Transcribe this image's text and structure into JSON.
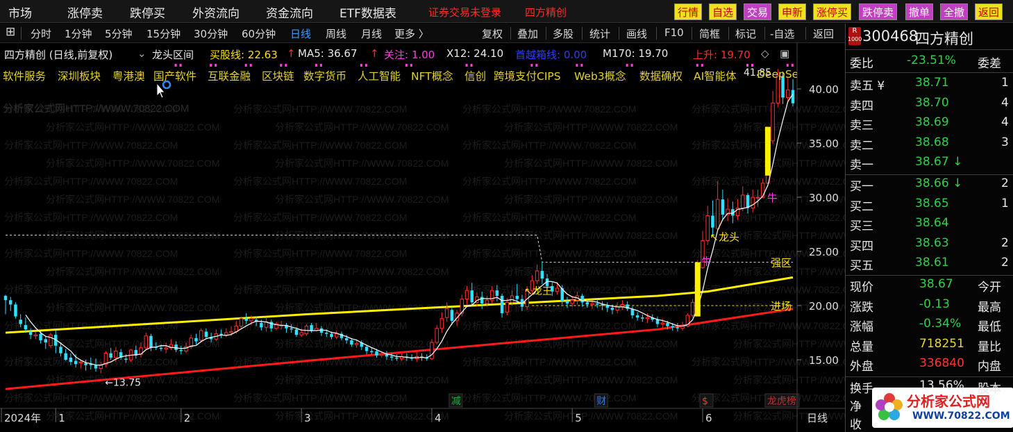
{
  "top_menu": {
    "items": [
      "市场",
      "涨停卖",
      "跌停买",
      "外资流向",
      "资金流向",
      "ETF数据表"
    ],
    "login": "证券交易未登录",
    "stock_title": "四方精创",
    "quick_buttons": [
      "行情",
      "自选",
      "交易",
      "申新",
      "涨停买",
      "跌停卖",
      "撤单",
      "全撤",
      "返回"
    ]
  },
  "toolbar": {
    "periods": [
      "分时",
      "1分钟",
      "5分钟",
      "15分钟",
      "30分钟",
      "60分钟",
      "日线",
      "周线",
      "月线",
      "更多 〉"
    ],
    "active": "日线",
    "actions": [
      "复权",
      "叠加",
      "多股",
      "统计",
      "画线",
      "F10",
      "简框",
      "标记",
      "-自选",
      "返回"
    ]
  },
  "indicator_line": {
    "name": "四方精创 (日线,前复权)",
    "formula": "龙头区间",
    "buy_line": "买股线: 22.63",
    "ma5": "MA5: 36.67",
    "focus": "关注: 1.00",
    "x12": "X12: 24.10",
    "breakout": "首越箱线: 0.00",
    "m170": "M170: 19.70",
    "rise": "上升: 19.70"
  },
  "concepts": [
    "软件服务",
    "深圳板块",
    "粤港澳",
    "国产软件",
    "互联金融",
    "区块链",
    "数字货币",
    "人工智能",
    "NFT概念",
    "信创",
    "跨境支付CIPS",
    "Web3概念",
    "数据确权",
    "AI智能体",
    "DeepSe"
  ],
  "watermark": "分析家公式网HTTP://WWW.70822.COM",
  "chart_labels": {
    "low_label": "←13.75",
    "high_label": "41.85",
    "dragon_head": "↖龙头",
    "strong_zone": "强区",
    "entry_zone": "进场",
    "bull_1": "牛",
    "bull_2": "牛",
    "king": "↖龙王",
    "events": [
      "减",
      "财",
      "$",
      "龙虎榜"
    ]
  },
  "chart_data": {
    "type": "candlestick",
    "y_ticks": [
      "40.00",
      "35.00",
      "30.00",
      "25.00",
      "20.00",
      "15.00"
    ],
    "ylim": [
      13.0,
      42.5
    ],
    "x_ticks": [
      "2024年",
      "1",
      "2",
      "3",
      "4",
      "5",
      "6"
    ],
    "period_label": "日线",
    "x_tick_days": [
      0,
      10,
      35,
      59,
      85,
      113,
      139
    ],
    "n_days": 158,
    "lines": {
      "red_rising": [
        {
          "d": 0,
          "v": 12.3
        },
        {
          "d": 60,
          "v": 14.9
        },
        {
          "d": 130,
          "v": 17.8
        },
        {
          "d": 157,
          "v": 19.7
        }
      ],
      "yellow_box": [
        {
          "d": 0,
          "v": 17.5
        },
        {
          "d": 60,
          "v": 19.2
        },
        {
          "d": 130,
          "v": 20.9
        },
        {
          "d": 140,
          "v": 21.3
        },
        {
          "d": 157,
          "v": 22.6
        }
      ],
      "white_dashed": [
        {
          "d": 0,
          "v": 26.5
        },
        {
          "d": 106,
          "v": 26.5
        },
        {
          "d": 107,
          "v": 24.0
        },
        {
          "d": 157,
          "v": 24.0
        }
      ],
      "yellow_dashed": [
        {
          "d": 105,
          "v": 20.0
        },
        {
          "d": 157,
          "v": 20.0
        }
      ]
    },
    "candles": [
      [
        0,
        20.9,
        20.5,
        21.0,
        19.2
      ],
      [
        1,
        20.5,
        20.1,
        20.8,
        19.5
      ],
      [
        2,
        20.1,
        19.0,
        20.3,
        18.8
      ],
      [
        3,
        18.7,
        18.3,
        19.2,
        18.0
      ],
      [
        4,
        18.2,
        17.8,
        18.9,
        17.5
      ],
      [
        5,
        17.6,
        17.3,
        17.9,
        16.9
      ],
      [
        6,
        17.2,
        17.3,
        17.6,
        16.9
      ],
      [
        7,
        17.4,
        16.8,
        17.6,
        16.5
      ],
      [
        8,
        16.9,
        16.6,
        17.2,
        16.0
      ],
      [
        9,
        16.3,
        17.3,
        17.5,
        16.1
      ],
      [
        10,
        17.3,
        16.3,
        17.7,
        15.6
      ],
      [
        11,
        16.2,
        15.6,
        16.6,
        15.3
      ],
      [
        12,
        15.6,
        15.0,
        16.0,
        14.9
      ],
      [
        13,
        15.2,
        14.8,
        15.6,
        14.5
      ],
      [
        14,
        14.9,
        14.6,
        15.5,
        14.3
      ],
      [
        15,
        14.8,
        14.8,
        15.0,
        14.2
      ],
      [
        16,
        14.7,
        14.5,
        15.0,
        14.0
      ],
      [
        17,
        14.6,
        14.5,
        15.2,
        14.1
      ],
      [
        18,
        14.5,
        14.2,
        15.1,
        13.9
      ],
      [
        19,
        14.2,
        14.5,
        14.8,
        13.75
      ],
      [
        20,
        14.6,
        15.6,
        15.8,
        14.3
      ],
      [
        21,
        15.6,
        15.2,
        16.1,
        15.0
      ],
      [
        22,
        15.2,
        15.8,
        16.2,
        14.8
      ],
      [
        23,
        15.7,
        15.2,
        16.0,
        15.0
      ],
      [
        24,
        15.1,
        15.0,
        15.5,
        14.7
      ],
      [
        25,
        15.0,
        15.9,
        16.0,
        14.8
      ],
      [
        26,
        15.9,
        15.4,
        16.3,
        15.1
      ],
      [
        27,
        15.5,
        16.1,
        16.6,
        15.2
      ],
      [
        28,
        16.1,
        17.2,
        17.5,
        15.9
      ],
      [
        29,
        17.2,
        16.1,
        17.4,
        15.8
      ],
      [
        30,
        16.2,
        16.1,
        16.6,
        15.9
      ],
      [
        31,
        16.1,
        16.0,
        16.4,
        15.8
      ],
      [
        32,
        16.0,
        16.1,
        16.6,
        15.6
      ],
      [
        33,
        16.1,
        16.4,
        16.9,
        15.9
      ],
      [
        34,
        16.4,
        15.9,
        16.7,
        15.7
      ],
      [
        35,
        15.9,
        15.8,
        16.3,
        15.5
      ],
      [
        36,
        15.8,
        16.2,
        16.6,
        15.6
      ],
      [
        37,
        16.2,
        17.0,
        17.3,
        16.0
      ],
      [
        38,
        17.0,
        16.7,
        17.4,
        16.4
      ],
      [
        39,
        16.8,
        17.7,
        17.9,
        16.6
      ],
      [
        40,
        17.6,
        17.1,
        17.9,
        16.9
      ],
      [
        41,
        17.1,
        16.9,
        17.5,
        16.6
      ],
      [
        42,
        16.9,
        17.4,
        17.8,
        16.7
      ],
      [
        43,
        17.4,
        17.3,
        17.8,
        17.0
      ],
      [
        44,
        17.3,
        17.5,
        17.9,
        17.1
      ],
      [
        45,
        17.5,
        17.6,
        18.1,
        17.2
      ],
      [
        46,
        17.6,
        18.1,
        18.6,
        17.4
      ],
      [
        47,
        18.1,
        18.8,
        19.0,
        17.9
      ],
      [
        48,
        18.8,
        18.6,
        19.3,
        18.3
      ],
      [
        49,
        18.6,
        18.8,
        19.1,
        18.2
      ],
      [
        50,
        18.7,
        18.5,
        19.0,
        18.1
      ],
      [
        51,
        18.4,
        18.0,
        18.7,
        17.7
      ],
      [
        52,
        18.0,
        18.5,
        18.9,
        17.6
      ],
      [
        53,
        18.5,
        17.9,
        18.7,
        17.6
      ],
      [
        54,
        17.9,
        18.3,
        18.5,
        17.7
      ],
      [
        55,
        18.2,
        18.2,
        18.6,
        17.8
      ],
      [
        56,
        18.2,
        17.9,
        18.4,
        17.5
      ],
      [
        57,
        17.9,
        17.8,
        18.3,
        17.5
      ],
      [
        58,
        17.8,
        17.3,
        18.0,
        17.1
      ],
      [
        59,
        17.3,
        17.5,
        17.9,
        17.1
      ],
      [
        60,
        17.4,
        18.1,
        18.3,
        17.2
      ],
      [
        61,
        18.2,
        17.7,
        18.4,
        17.5
      ],
      [
        62,
        17.7,
        17.9,
        18.4,
        17.6
      ],
      [
        63,
        17.9,
        17.5,
        18.1,
        17.2
      ],
      [
        64,
        17.5,
        17.4,
        17.8,
        17.1
      ],
      [
        65,
        17.4,
        17.1,
        17.6,
        16.9
      ],
      [
        66,
        17.1,
        17.4,
        17.7,
        16.9
      ],
      [
        67,
        17.4,
        17.0,
        17.6,
        16.8
      ],
      [
        68,
        17.0,
        16.8,
        17.3,
        16.5
      ],
      [
        69,
        16.8,
        16.4,
        17.0,
        16.2
      ],
      [
        70,
        16.4,
        16.5,
        16.9,
        16.1
      ],
      [
        71,
        16.6,
        16.2,
        16.8,
        15.9
      ],
      [
        72,
        16.2,
        15.8,
        16.4,
        15.5
      ],
      [
        73,
        15.8,
        15.7,
        16.1,
        15.5
      ],
      [
        74,
        15.8,
        15.4,
        16.0,
        15.2
      ],
      [
        75,
        15.4,
        15.5,
        15.8,
        15.2
      ],
      [
        76,
        15.5,
        15.3,
        15.8,
        15.0
      ],
      [
        77,
        15.3,
        15.2,
        15.6,
        14.9
      ],
      [
        78,
        15.2,
        15.1,
        15.5,
        14.9
      ],
      [
        79,
        15.1,
        15.3,
        15.6,
        14.9
      ],
      [
        80,
        15.3,
        15.2,
        15.6,
        14.9
      ],
      [
        81,
        15.2,
        15.1,
        15.5,
        14.9
      ],
      [
        82,
        15.1,
        15.3,
        15.7,
        14.8
      ],
      [
        83,
        15.3,
        15.2,
        15.6,
        14.9
      ],
      [
        84,
        15.2,
        15.1,
        15.5,
        14.9
      ],
      [
        85,
        15.1,
        16.6,
        16.9,
        15.0
      ],
      [
        86,
        16.6,
        17.9,
        18.2,
        16.4
      ],
      [
        87,
        17.9,
        18.8,
        19.4,
        17.5
      ],
      [
        88,
        18.9,
        19.7,
        20.3,
        18.5
      ],
      [
        89,
        19.6,
        18.6,
        19.9,
        18.2
      ],
      [
        90,
        18.6,
        19.3,
        19.6,
        18.1
      ],
      [
        91,
        19.3,
        20.6,
        21.0,
        19.0
      ],
      [
        92,
        20.6,
        21.4,
        21.8,
        20.1
      ],
      [
        93,
        21.4,
        20.3,
        22.1,
        19.9
      ],
      [
        94,
        20.3,
        20.8,
        21.2,
        19.9
      ],
      [
        95,
        20.8,
        20.2,
        21.3,
        19.7
      ],
      [
        96,
        20.2,
        20.5,
        20.9,
        19.9
      ],
      [
        97,
        20.5,
        21.4,
        21.8,
        20.2
      ],
      [
        98,
        21.4,
        20.9,
        21.9,
        20.4
      ],
      [
        99,
        20.9,
        19.3,
        21.1,
        18.9
      ],
      [
        100,
        19.4,
        20.3,
        20.7,
        19.1
      ],
      [
        101,
        20.3,
        20.9,
        21.4,
        20.0
      ],
      [
        102,
        20.9,
        20.6,
        22.0,
        20.3
      ],
      [
        103,
        20.6,
        19.9,
        21.0,
        19.5
      ],
      [
        104,
        19.9,
        21.4,
        21.8,
        19.6
      ],
      [
        105,
        21.4,
        22.3,
        22.8,
        21.0
      ],
      [
        106,
        22.3,
        23.2,
        23.8,
        22.0
      ],
      [
        107,
        23.2,
        22.5,
        24.0,
        22.0
      ],
      [
        108,
        22.5,
        21.8,
        22.9,
        21.4
      ],
      [
        109,
        21.8,
        21.3,
        22.2,
        20.9
      ],
      [
        110,
        21.3,
        21.6,
        22.2,
        21.0
      ],
      [
        111,
        21.6,
        20.4,
        21.9,
        20.1
      ],
      [
        112,
        20.4,
        20.2,
        20.8,
        19.8
      ],
      [
        113,
        20.2,
        20.5,
        20.9,
        19.9
      ],
      [
        114,
        20.5,
        20.9,
        21.3,
        20.1
      ],
      [
        115,
        20.9,
        20.3,
        21.1,
        19.9
      ],
      [
        116,
        20.3,
        20.1,
        20.6,
        19.8
      ],
      [
        117,
        20.1,
        20.2,
        20.5,
        19.7
      ],
      [
        118,
        20.2,
        20.1,
        20.6,
        19.8
      ],
      [
        119,
        20.1,
        20.0,
        20.4,
        19.6
      ],
      [
        120,
        20.0,
        19.8,
        20.3,
        19.4
      ],
      [
        121,
        19.8,
        19.6,
        20.1,
        19.2
      ],
      [
        122,
        19.6,
        19.9,
        20.3,
        19.3
      ],
      [
        123,
        19.9,
        20.1,
        20.5,
        19.6
      ],
      [
        124,
        20.1,
        19.7,
        20.4,
        19.5
      ],
      [
        125,
        19.7,
        19.1,
        19.9,
        18.8
      ],
      [
        126,
        19.1,
        18.9,
        19.4,
        18.6
      ],
      [
        127,
        18.9,
        18.8,
        19.2,
        18.5
      ],
      [
        128,
        18.8,
        18.9,
        19.3,
        18.4
      ],
      [
        129,
        18.9,
        18.7,
        19.2,
        18.5
      ],
      [
        130,
        18.7,
        18.3,
        19.0,
        18.0
      ],
      [
        131,
        18.3,
        18.4,
        18.8,
        17.9
      ],
      [
        132,
        18.4,
        18.1,
        18.6,
        17.8
      ],
      [
        133,
        18.1,
        18.0,
        18.4,
        17.7
      ],
      [
        134,
        18.0,
        17.9,
        18.4,
        17.6
      ],
      [
        135,
        17.9,
        18.1,
        18.5,
        17.7
      ],
      [
        136,
        18.1,
        19.1,
        19.3,
        18.0
      ],
      [
        137,
        19.1,
        20.3,
        20.6,
        18.9
      ],
      [
        138,
        20.3,
        23.5,
        24.2,
        20.1
      ],
      [
        139,
        23.5,
        26.0,
        26.9,
        23.4
      ],
      [
        140,
        26.0,
        28.3,
        29.2,
        25.6
      ],
      [
        141,
        28.3,
        27.2,
        29.7,
        26.4
      ],
      [
        142,
        27.1,
        29.8,
        31.5,
        26.9
      ],
      [
        143,
        29.8,
        28.4,
        30.7,
        27.9
      ],
      [
        144,
        28.4,
        28.9,
        29.9,
        27.8
      ],
      [
        145,
        28.9,
        28.3,
        29.6,
        27.6
      ],
      [
        146,
        28.3,
        29.0,
        29.8,
        27.9
      ],
      [
        147,
        29.0,
        30.2,
        31.0,
        28.7
      ],
      [
        148,
        30.2,
        29.0,
        30.4,
        28.5
      ],
      [
        149,
        29.0,
        30.0,
        30.7,
        28.6
      ],
      [
        150,
        30.0,
        30.0,
        30.7,
        29.1
      ],
      [
        151,
        30.0,
        31.3,
        31.7,
        29.9
      ],
      [
        152,
        31.3,
        35.2,
        36.2,
        31.0
      ],
      [
        153,
        35.2,
        38.7,
        39.8,
        34.9
      ],
      [
        154,
        38.7,
        41.2,
        41.85,
        38.3
      ],
      [
        155,
        41.2,
        39.2,
        41.6,
        38.6
      ],
      [
        156,
        39.2,
        39.9,
        41.0,
        38.8
      ],
      [
        157,
        39.9,
        38.67,
        40.9,
        38.4
      ]
    ],
    "volume_bars": [
      {
        "d": 138,
        "top": 24.0,
        "bottom": 19.0
      },
      {
        "d": 152,
        "top": 36.5,
        "bottom": 32.0
      }
    ]
  },
  "right_panel": {
    "code": "300468",
    "name": "四方精创",
    "badge_top": "R",
    "badge_bottom": "1000",
    "weibi_label": "委比",
    "weibi_value": "-23.51%",
    "weicha_label": "委差",
    "sell": [
      {
        "label": "卖五 ¥",
        "price": "38.71",
        "vol": "1"
      },
      {
        "label": "卖四",
        "price": "38.70",
        "vol": "4"
      },
      {
        "label": "卖三",
        "price": "38.69",
        "vol": "4"
      },
      {
        "label": "卖二",
        "price": "38.68",
        "vol": "3"
      },
      {
        "label": "卖一",
        "price": "38.67 ↓",
        "vol": ""
      }
    ],
    "buy": [
      {
        "label": "买一",
        "price": "38.66 ↓",
        "vol": "2"
      },
      {
        "label": "买二",
        "price": "38.65",
        "vol": "1"
      },
      {
        "label": "买三",
        "price": "38.64",
        "vol": ""
      },
      {
        "label": "买四",
        "price": "38.63",
        "vol": "2"
      },
      {
        "label": "买五",
        "price": "38.61",
        "vol": "2"
      }
    ],
    "quote": [
      {
        "label": "现价",
        "value": "38.67",
        "label2": "今开"
      },
      {
        "label": "涨跌",
        "value": "-0.13",
        "label2": "最高"
      },
      {
        "label": "涨幅",
        "value": "-0.34%",
        "label2": "最低"
      },
      {
        "label": "总量",
        "value": "718251",
        "label2": "量比"
      },
      {
        "label": "外盘",
        "value": "336840",
        "label2": "内盘"
      }
    ],
    "extra": [
      {
        "label": "换手",
        "value": "13.56%",
        "label2": "股本"
      },
      {
        "label": "净",
        "value": "",
        "label2": ""
      },
      {
        "label": "收",
        "value": "",
        "label2": ""
      }
    ],
    "logo_text": "分析家公式网",
    "logo_url": "WWW.70822.COM"
  }
}
